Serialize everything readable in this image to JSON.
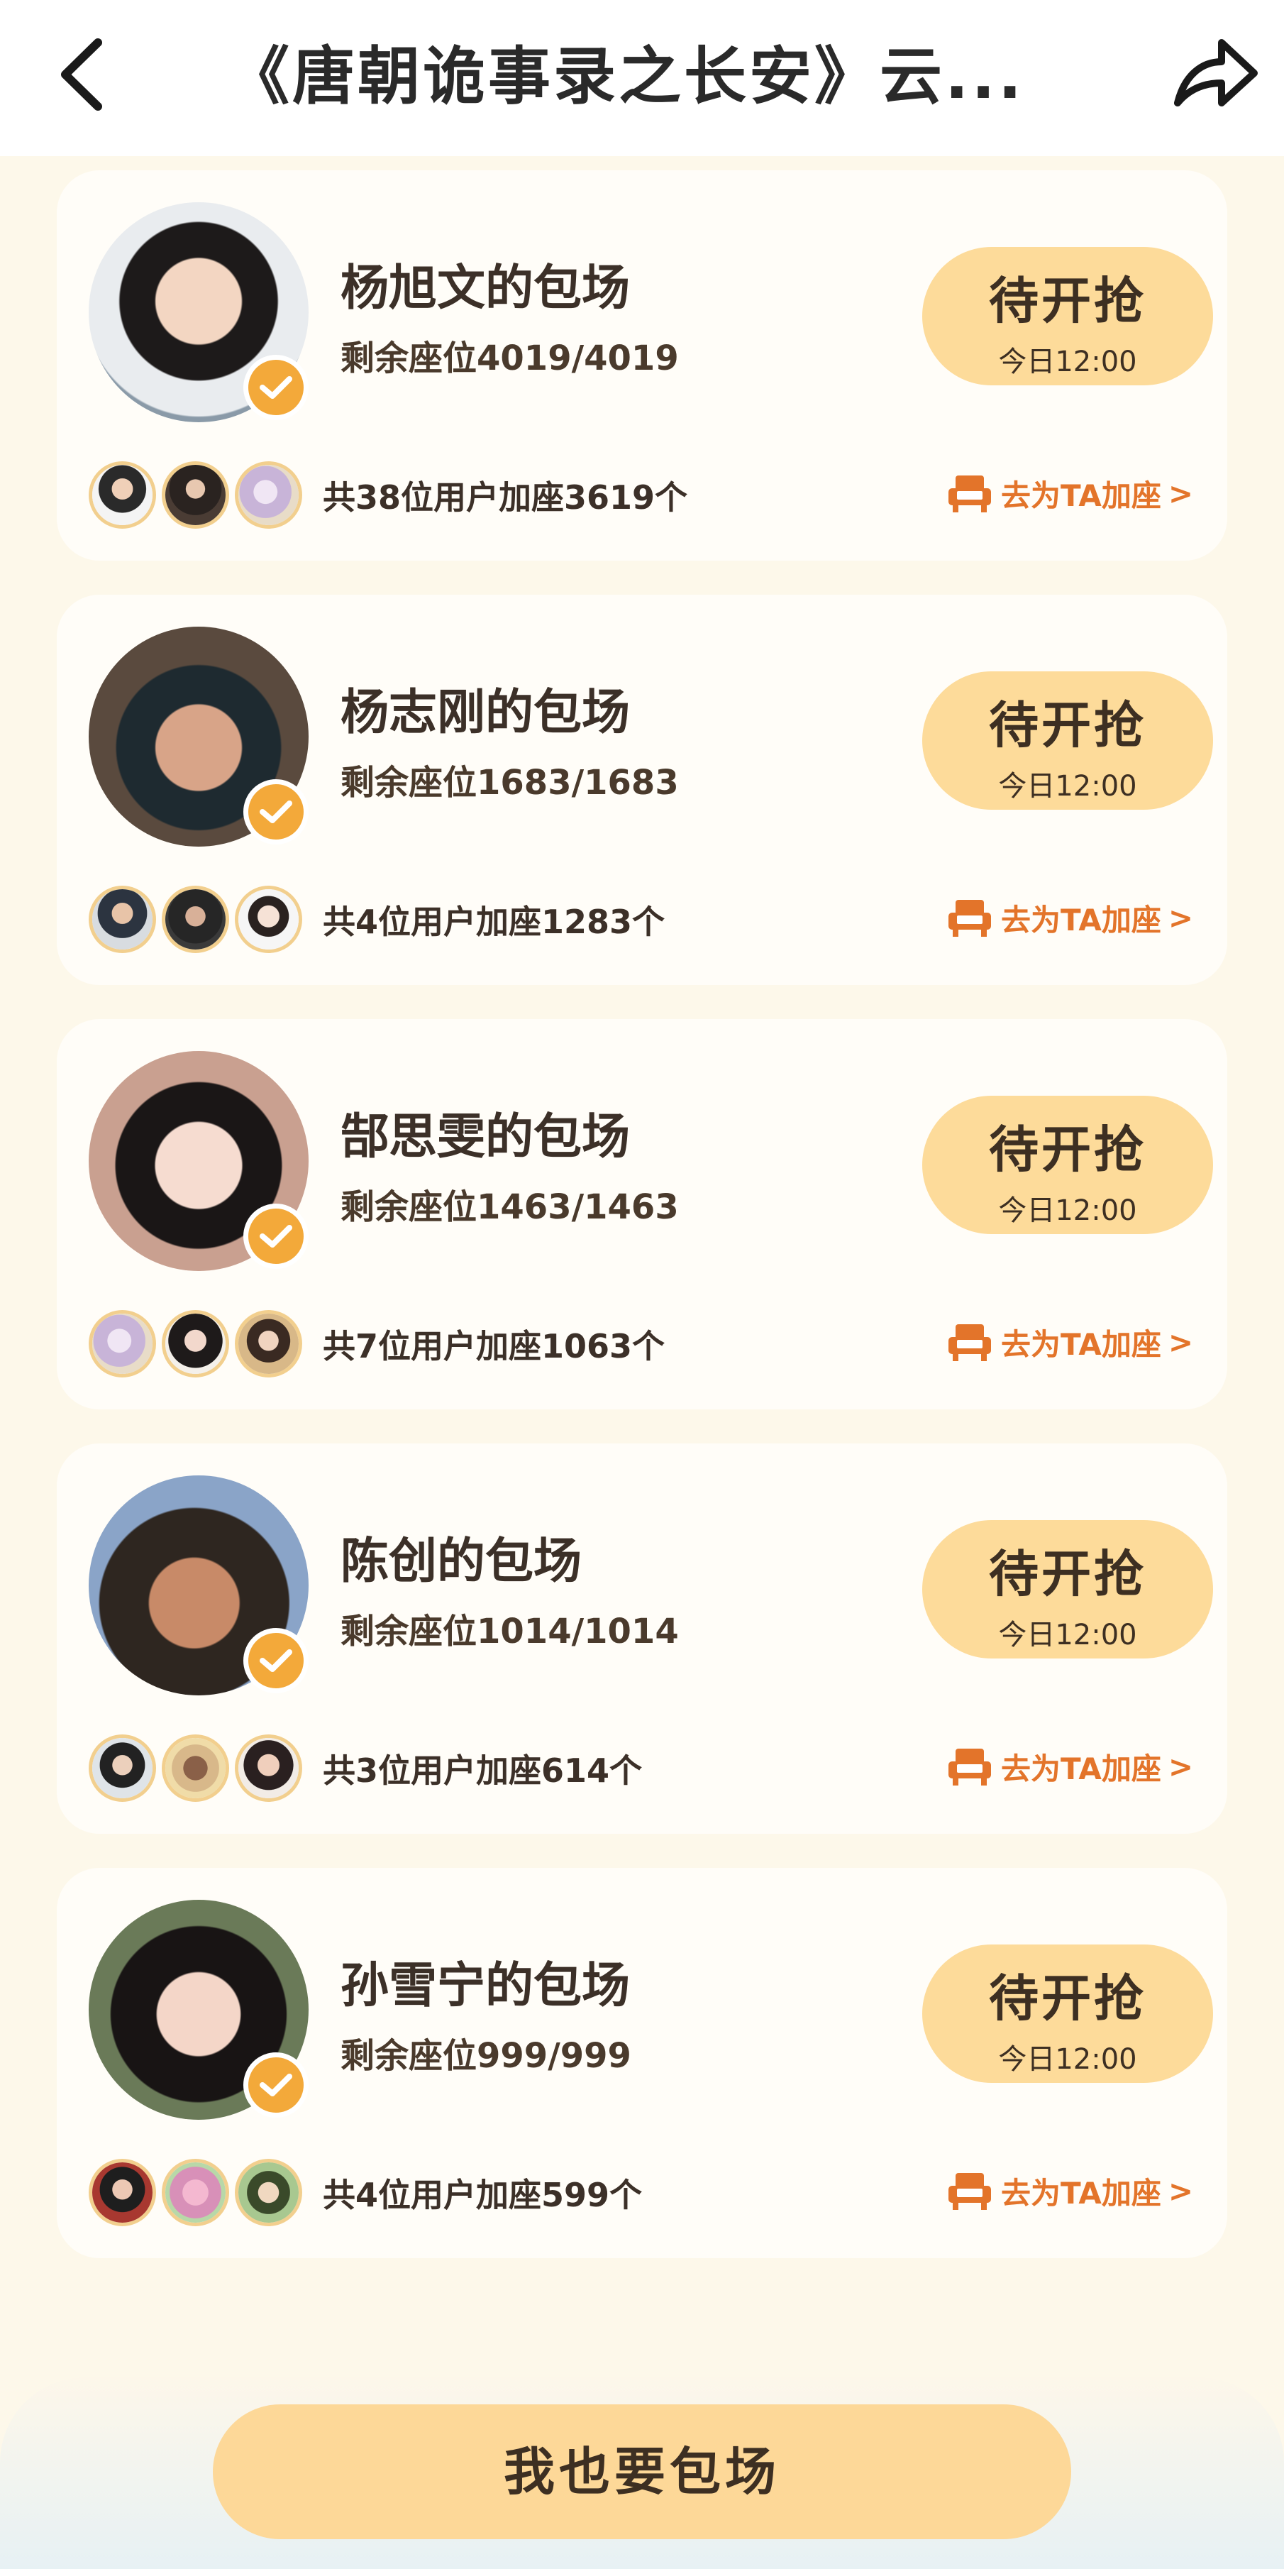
{
  "header": {
    "title": "《唐朝诡事录之长安》云...",
    "back_icon": "chevron-left-icon",
    "share_icon": "share-arrow-icon"
  },
  "cards": [
    {
      "name": "杨旭文的包场",
      "seats": "剩余座位4019/4019",
      "status": "待开抢",
      "time": "今日12:00",
      "joined": "共38位用户加座3619个",
      "link": "去为TA加座"
    },
    {
      "name": "杨志刚的包场",
      "seats": "剩余座位1683/1683",
      "status": "待开抢",
      "time": "今日12:00",
      "joined": "共4位用户加座1283个",
      "link": "去为TA加座"
    },
    {
      "name": "郜思雯的包场",
      "seats": "剩余座位1463/1463",
      "status": "待开抢",
      "time": "今日12:00",
      "joined": "共7位用户加座1063个",
      "link": "去为TA加座"
    },
    {
      "name": "陈创的包场",
      "seats": "剩余座位1014/1014",
      "status": "待开抢",
      "time": "今日12:00",
      "joined": "共3位用户加座614个",
      "link": "去为TA加座"
    },
    {
      "name": "孙雪宁的包场",
      "seats": "剩余座位999/999",
      "status": "待开抢",
      "time": "今日12:00",
      "joined": "共4位用户加座599个",
      "link": "去为TA加座"
    }
  ],
  "cta": {
    "label": "我也要包场"
  },
  "colors": {
    "accent": "#e3742a",
    "button": "#fddb9a",
    "verified": "#f3a93a",
    "background": "#fdf8ea"
  }
}
